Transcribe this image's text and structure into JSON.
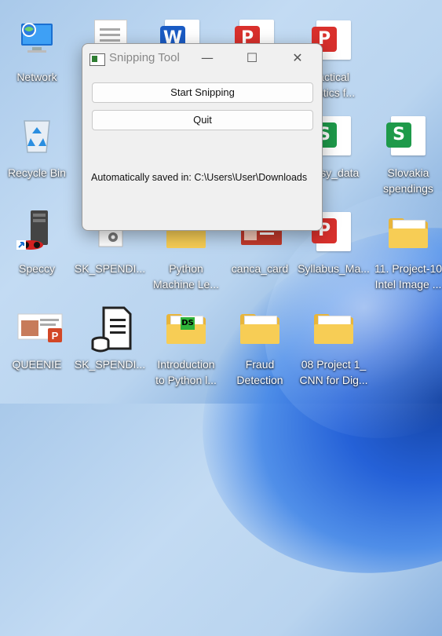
{
  "window": {
    "title": "Snipping Tool",
    "buttons": {
      "start": "Start Snipping",
      "quit": "Quit"
    },
    "status_prefix": "Automatically saved in:",
    "status_path": "C:\\Users\\User\\Downloads",
    "controls": {
      "minimize": "—",
      "maximize": "☐",
      "close": "✕"
    }
  },
  "desktop": {
    "items": [
      {
        "label": "Network",
        "icon": "network-icon"
      },
      {
        "label": "Recycle Bin",
        "icon": "recycle-bin-icon"
      },
      {
        "label": "Speccy",
        "icon": "speccy-icon"
      },
      {
        "label": "QUEENIE",
        "icon": "powerpoint-icon"
      },
      {
        "label": "SK_SPENDI...",
        "icon": "settings-file-icon"
      },
      {
        "label": "SK_SPENDI...",
        "icon": "database-file-icon"
      },
      {
        "label": "Python\nMachine Le...",
        "icon": "folder-icon"
      },
      {
        "label": "Introduction\nto Python l...",
        "icon": "folder-icon"
      },
      {
        "label": "canca_card",
        "icon": "image-file-icon"
      },
      {
        "label": "Fraud\nDetection",
        "icon": "folder-icon"
      },
      {
        "label": "actical\ntistics f...",
        "icon": "pdf-icon"
      },
      {
        "label": "epsy_data",
        "icon": "spreadsheet-icon"
      },
      {
        "label": "Syllabus_Ma...",
        "icon": "pdf-icon"
      },
      {
        "label": "08 Project 1_\nCNN for Dig...",
        "icon": "folder-icon"
      },
      {
        "label": "Slovakia\nspendings",
        "icon": "spreadsheet-icon"
      },
      {
        "label": "11. Project-10\nIntel Image ...",
        "icon": "folder-icon"
      }
    ]
  },
  "colors": {
    "folder": "#e8b53b",
    "pdf": "#d9302c",
    "sheet": "#1e9a4a",
    "word": "#1a5bc4"
  }
}
